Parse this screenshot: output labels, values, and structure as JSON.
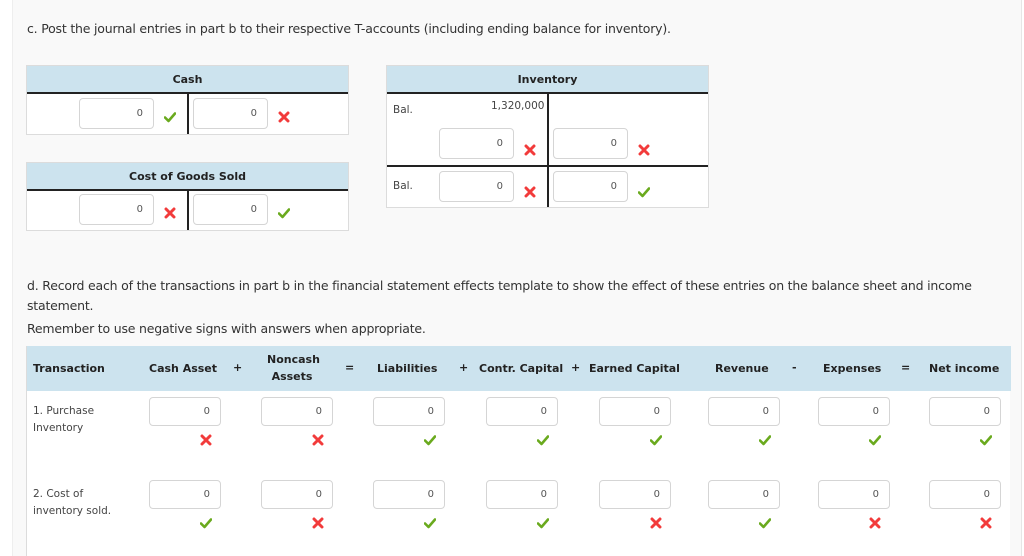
{
  "part_c": {
    "instruction": "c. Post the journal entries in part b to their respective T-accounts (including ending balance for inventory).",
    "cash": {
      "title": "Cash",
      "debit": {
        "value": "0",
        "status": "correct"
      },
      "credit": {
        "value": "0",
        "status": "incorrect"
      }
    },
    "cogs": {
      "title": "Cost of Goods Sold",
      "debit": {
        "value": "0",
        "status": "incorrect"
      },
      "credit": {
        "value": "0",
        "status": "correct"
      }
    },
    "inventory": {
      "title": "Inventory",
      "beginning_label": "Bal.",
      "beginning_balance": "1,320,000",
      "debit": {
        "value": "0",
        "status": "incorrect"
      },
      "credit": {
        "value": "0",
        "status": "incorrect"
      },
      "ending_label": "Bal.",
      "ending_debit": {
        "value": "0",
        "status": "incorrect"
      },
      "ending_credit": {
        "value": "0",
        "status": "correct"
      }
    }
  },
  "part_d": {
    "instruction": "d. Record each of the transactions in part b in the financial statement effects template to show the effect of these entries on the balance sheet and income statement.",
    "reminder": "Remember to use negative signs with answers when appropriate.",
    "columns": {
      "transaction": "Transaction",
      "cash_asset": "Cash Asset",
      "noncash_assets_1": "Noncash",
      "noncash_assets_2": "Assets",
      "liabilities": "Liabilities",
      "contr_capital": "Contr. Capital",
      "earned_capital": "Earned Capital",
      "revenue": "Revenue",
      "expenses": "Expenses",
      "net_income": "Net income"
    },
    "operators": {
      "plus1": "+",
      "equals1": "=",
      "plus2": "+",
      "plus3": "+",
      "minus": "-",
      "equals2": "="
    },
    "rows": [
      {
        "label_line1": "1. Purchase",
        "label_line2": "Inventory",
        "cells": [
          {
            "value": "0",
            "status": "incorrect"
          },
          {
            "value": "0",
            "status": "incorrect"
          },
          {
            "value": "0",
            "status": "correct"
          },
          {
            "value": "0",
            "status": "correct"
          },
          {
            "value": "0",
            "status": "correct"
          },
          {
            "value": "0",
            "status": "correct"
          },
          {
            "value": "0",
            "status": "correct"
          },
          {
            "value": "0",
            "status": "correct"
          }
        ]
      },
      {
        "label_line1": "2. Cost of",
        "label_line2": "inventory sold.",
        "cells": [
          {
            "value": "0",
            "status": "correct"
          },
          {
            "value": "0",
            "status": "incorrect"
          },
          {
            "value": "0",
            "status": "correct"
          },
          {
            "value": "0",
            "status": "correct"
          },
          {
            "value": "0",
            "status": "incorrect"
          },
          {
            "value": "0",
            "status": "correct"
          },
          {
            "value": "0",
            "status": "incorrect"
          },
          {
            "value": "0",
            "status": "incorrect"
          }
        ]
      }
    ]
  },
  "colors": {
    "correct": "#6aaa1e",
    "incorrect": "#f23b3b",
    "header_bg": "#cce3ee"
  }
}
